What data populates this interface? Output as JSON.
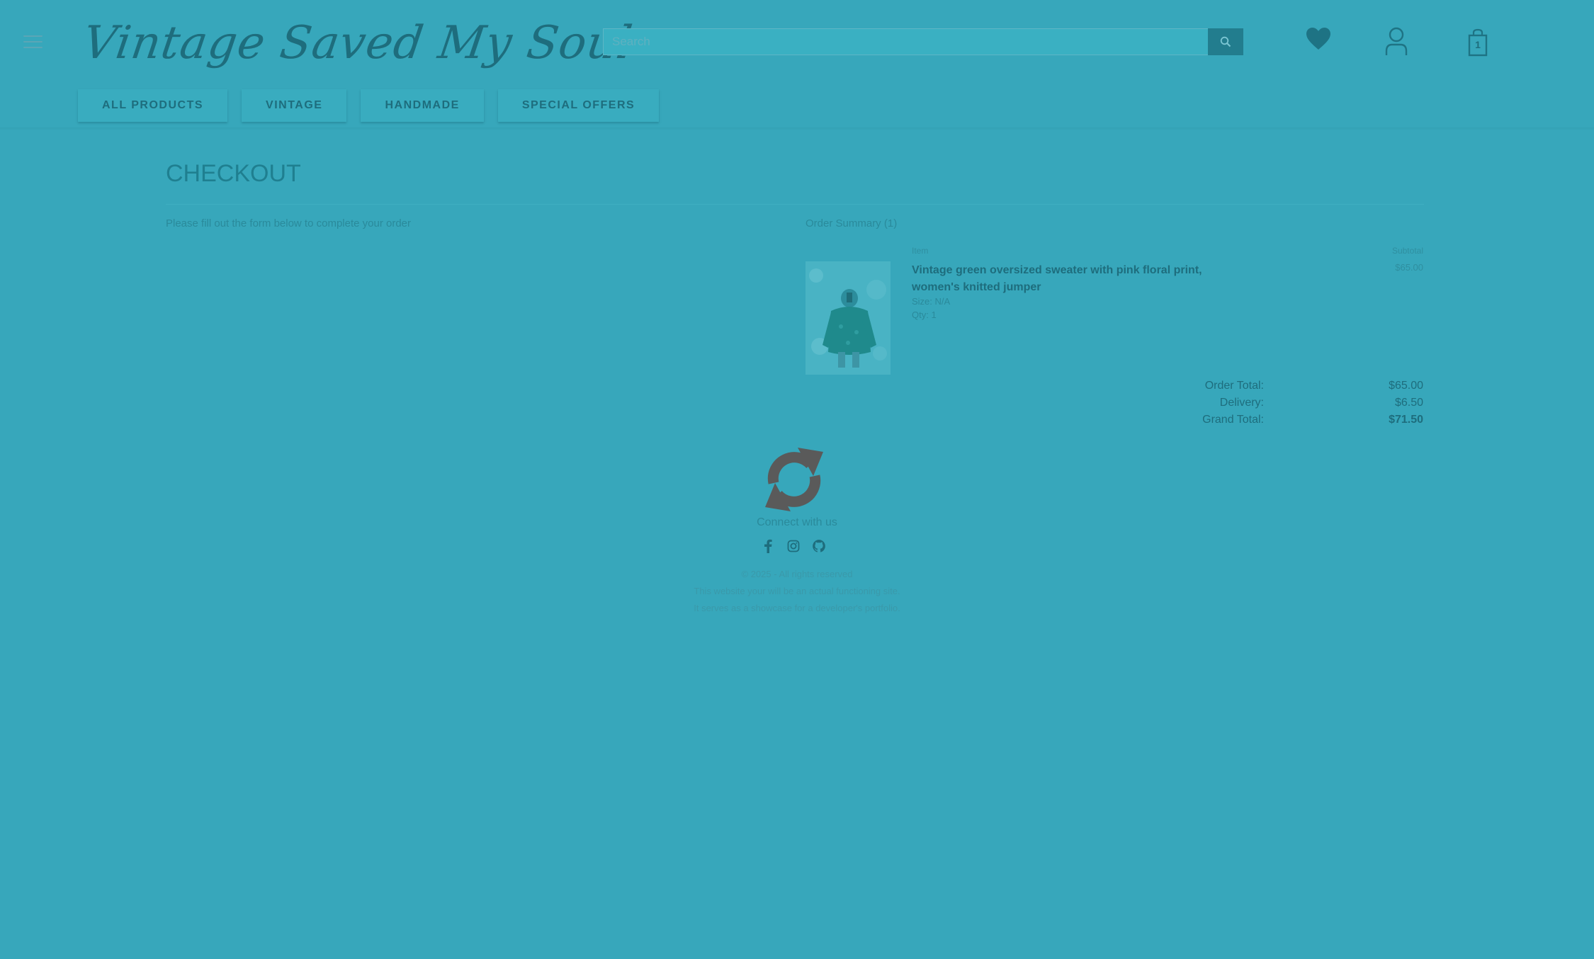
{
  "header": {
    "logo_text": "Vintage Saved My Soul",
    "search_placeholder": "Search",
    "cart_count": "1"
  },
  "icons": {
    "menu": "hamburger-icon",
    "search": "search-icon",
    "wishlist": "heart-icon",
    "account": "user-icon",
    "cart": "shopping-bag-icon",
    "loading": "refresh-icon",
    "social": [
      "facebook-icon",
      "instagram-icon",
      "github-icon"
    ]
  },
  "nav": {
    "items": [
      "ALL PRODUCTS",
      "VINTAGE",
      "HANDMADE",
      "SPECIAL OFFERS"
    ]
  },
  "checkout": {
    "title": "CHECKOUT",
    "intro": "Please fill out the form below to complete your order",
    "summary_title": "Order Summary (1)",
    "col_item": "Item",
    "col_subtotal": "Subtotal",
    "product": {
      "name": "Vintage green oversized sweater with pink floral print, women's knitted jumper",
      "size": "Size: N/A",
      "qty": "Qty: 1",
      "subtotal": "$65.00"
    },
    "totals": {
      "order_total_label": "Order Total:",
      "order_total": "$65.00",
      "delivery_label": "Delivery:",
      "delivery": "$6.50",
      "grand_total_label": "Grand Total:",
      "grand_total": "$71.50"
    }
  },
  "footer": {
    "connect": "Connect with us",
    "copyright": "© 2025 - All rights reserved",
    "disclaimer1": "This website your will be an actual functioning site.",
    "disclaimer2": "It serves as a showcase for a developer's portfolio."
  },
  "colors": {
    "overlay": "#37a7bb",
    "accent": "#1e6d7d",
    "spinner": "#555555"
  }
}
